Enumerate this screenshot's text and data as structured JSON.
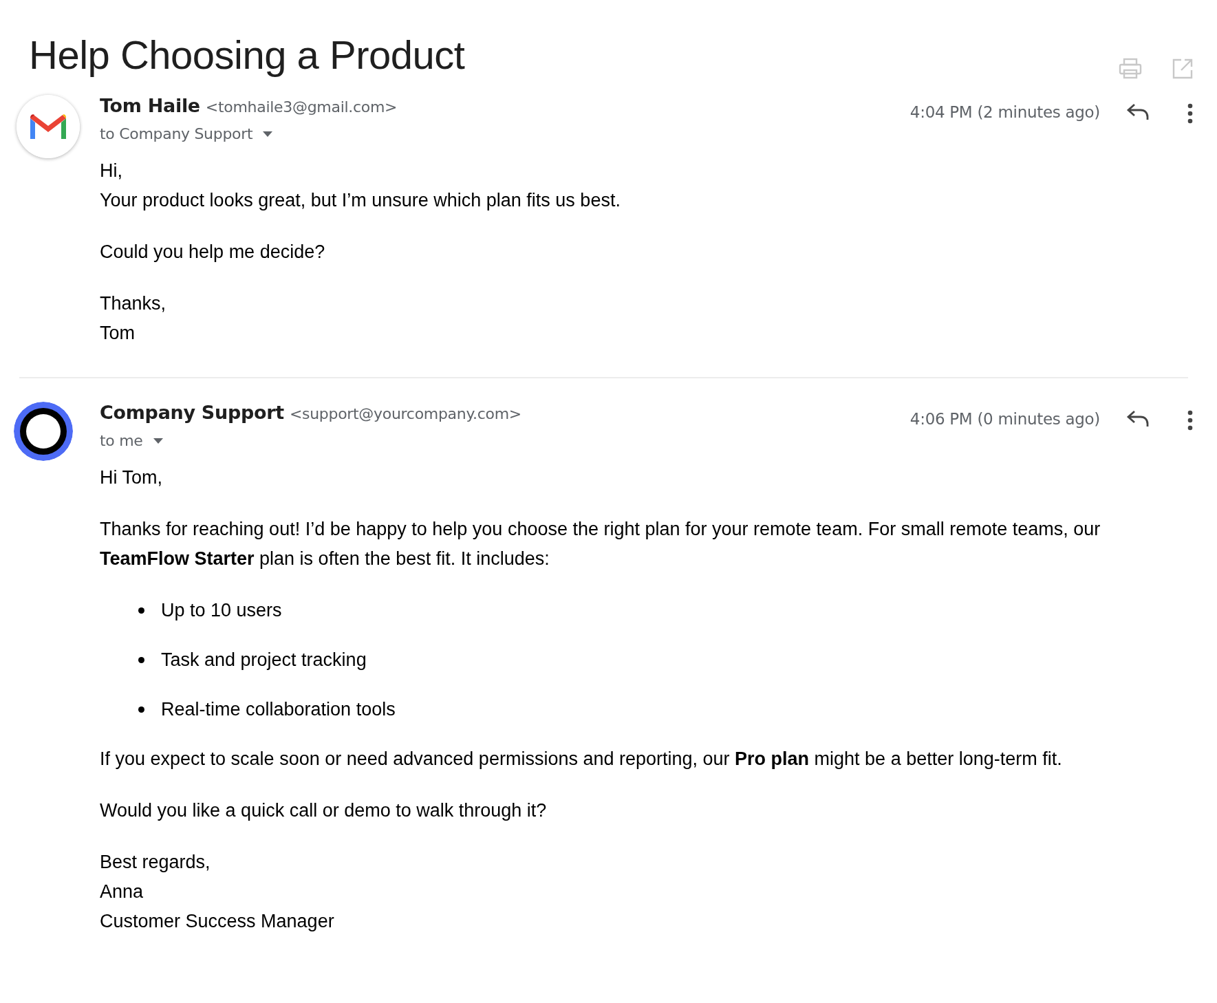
{
  "subject": "Help Choosing a Product",
  "messages": [
    {
      "avatar": {
        "kind": "mail-logo"
      },
      "sender_name": "Tom Haile",
      "sender_email": "<tomhaile3@gmail.com>",
      "recipient": "to Company Support",
      "time": "4:04 PM (2 minutes ago)",
      "body": [
        {
          "kind": "paragraph",
          "lines": [
            "Hi,",
            "Your product looks great, but I’m unsure which plan fits us best."
          ]
        },
        {
          "kind": "paragraph",
          "lines": [
            "Could you help me decide?"
          ]
        },
        {
          "kind": "paragraph",
          "lines": [
            "Thanks,",
            "Tom"
          ]
        }
      ]
    },
    {
      "avatar": {
        "kind": "ring"
      },
      "sender_name": "Company Support",
      "sender_email": "<support@yourcompany.com>",
      "recipient": "to me",
      "time": "4:06 PM (0 minutes ago)",
      "body": [
        {
          "kind": "paragraph",
          "lines": [
            "Hi Tom,"
          ]
        },
        {
          "kind": "paragraph",
          "lines": [
            "Thanks for reaching out! I’d be happy to help you choose the right plan for your remote team. For small remote teams, our **TeamFlow Starter** plan is often the best fit. It includes:"
          ]
        },
        {
          "kind": "list",
          "items": [
            "Up to 10 users",
            "Task and project tracking",
            "Real-time collaboration tools"
          ]
        },
        {
          "kind": "paragraph",
          "lines": [
            "If you expect to scale soon or need advanced permissions and reporting, our **Pro plan** might be a better long-term fit."
          ]
        },
        {
          "kind": "paragraph",
          "lines": [
            "Would you like a quick call or demo to walk through it?"
          ]
        },
        {
          "kind": "paragraph",
          "lines": [
            "Best regards,",
            "Anna",
            "Customer Success Manager"
          ]
        }
      ]
    }
  ]
}
